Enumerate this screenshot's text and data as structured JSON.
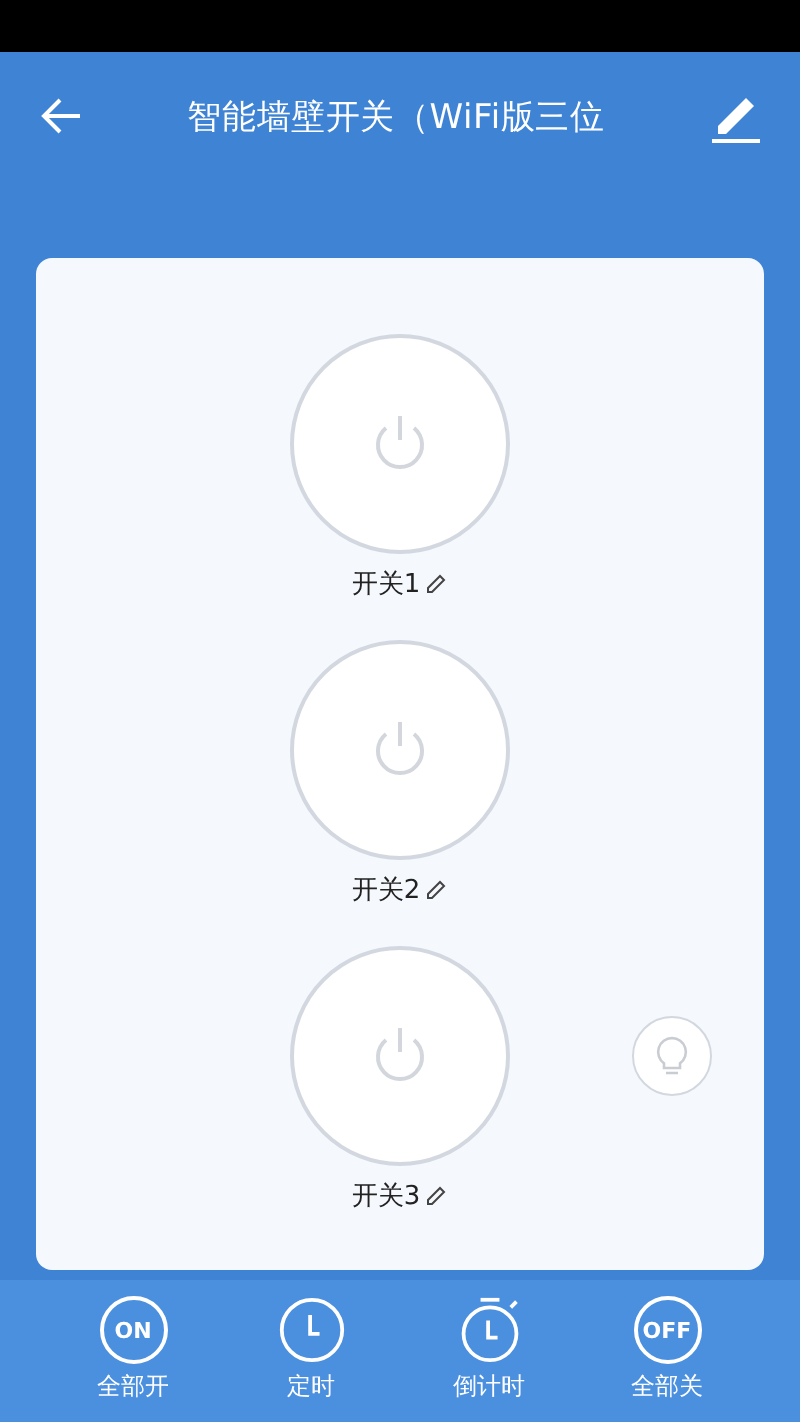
{
  "header": {
    "title": "智能墙壁开关（WiFi版三位"
  },
  "switches": [
    {
      "label": "开关1",
      "on": false
    },
    {
      "label": "开关2",
      "on": false
    },
    {
      "label": "开关3",
      "on": false
    }
  ],
  "bottom_bar": [
    {
      "kind": "on",
      "icon_text": "ON",
      "label": "全部开"
    },
    {
      "kind": "clock",
      "label": "定时"
    },
    {
      "kind": "timer",
      "label": "倒计时"
    },
    {
      "kind": "off",
      "icon_text": "OFF",
      "label": "全部关"
    }
  ]
}
